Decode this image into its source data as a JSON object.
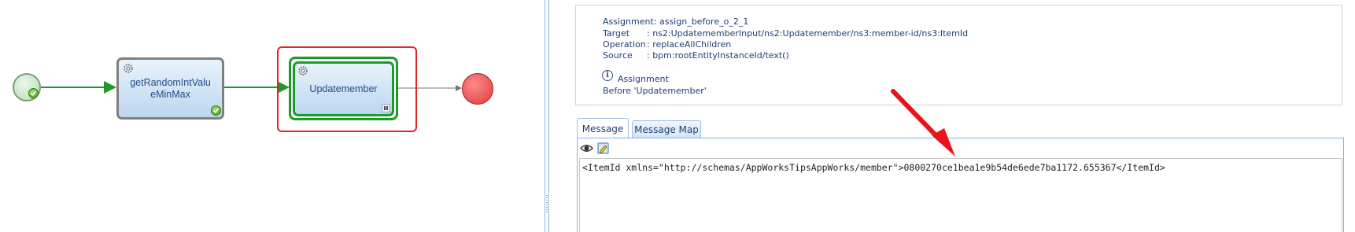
{
  "process": {
    "task1": {
      "label_line1": "getRandomIntValu",
      "label_line2": "eMinMax"
    },
    "task2": {
      "label": "Updatemember"
    }
  },
  "details": {
    "assignment_label": "Assignment:",
    "assignment_value": "assign_before_o_2_1",
    "target_label": "Target",
    "target_value": ": ns2:UpdatememberInput/ns2:Updatemember/ns3:member-id/ns3:ItemId",
    "operation_label": "Operation",
    "operation_value": ": replaceAllChildren",
    "source_label": "Source",
    "source_value": ": bpm:rootEntityInstanceId/text()",
    "info_title": "Assignment",
    "info_subtitle": "Before 'Updatemember'"
  },
  "tabs": {
    "message": "Message",
    "message_map": "Message Map"
  },
  "editor": {
    "content": "<ItemId xmlns=\"http://schemas/AppWorksTipsAppWorks/member\">0800270ce1bea1e9b54de6ede7ba1172.655367</ItemId>"
  },
  "icons": [
    "check-icon",
    "gear-icon",
    "pause-icon",
    "eye-icon",
    "edit-icon",
    "info-icon"
  ],
  "colors": {
    "accent_red": "#e2252b",
    "flow_green": "#1c9a2b",
    "text_blue": "#1f3f73"
  }
}
